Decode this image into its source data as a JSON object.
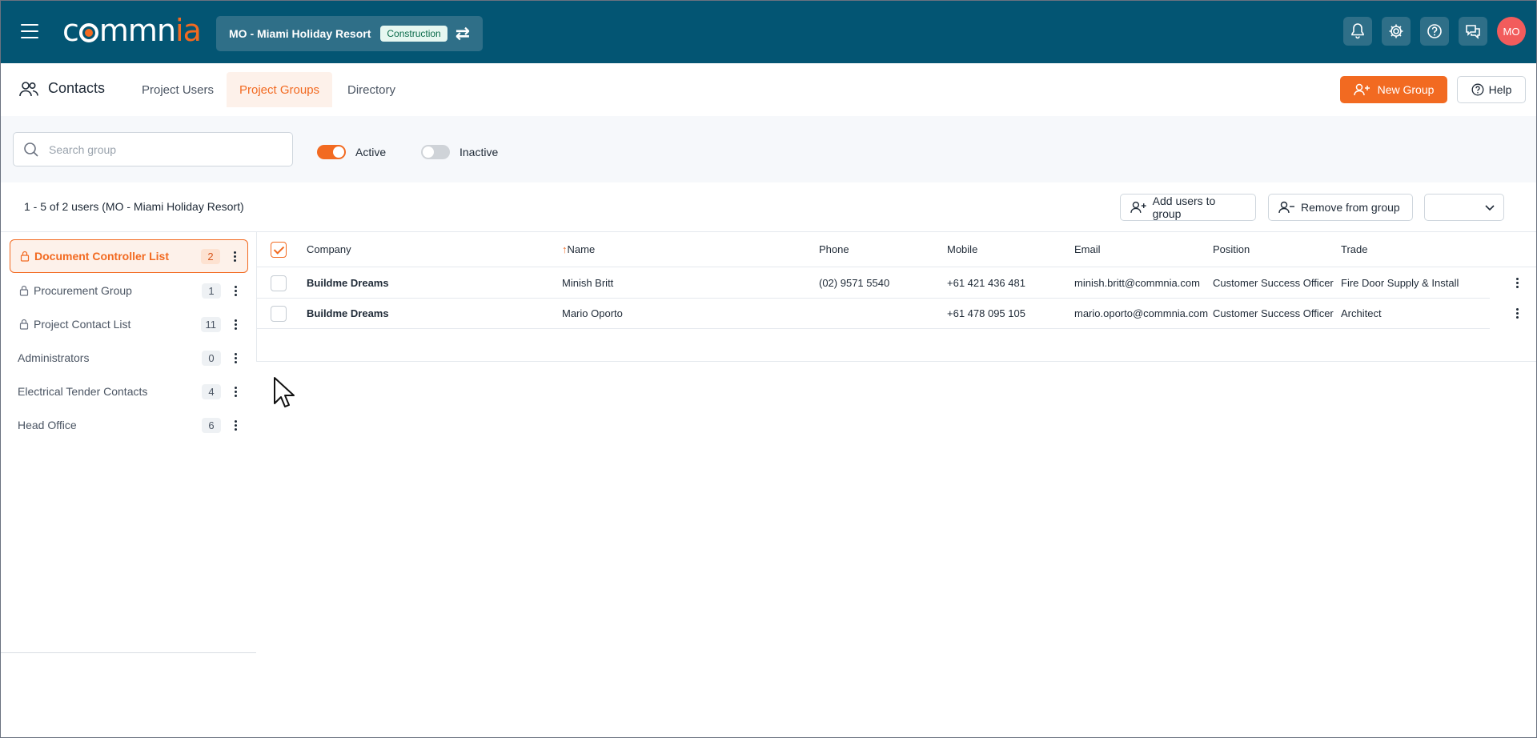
{
  "topbar": {
    "logo_part1": "c",
    "logo_part2": "mmn",
    "logo_accent": "ia",
    "project_name": "MO - Miami Holiday Resort",
    "project_badge": "Construction",
    "avatar_initials": "MO",
    "colors": {
      "bar": "#035573",
      "accent": "#f26a21",
      "avatar": "#f25c5c"
    }
  },
  "nav": {
    "title": "Contacts",
    "tabs": [
      {
        "label": "Project Users",
        "active": false
      },
      {
        "label": "Project Groups",
        "active": true
      },
      {
        "label": "Directory",
        "active": false
      }
    ],
    "new_group_label": "New Group",
    "help_label": "Help"
  },
  "filters": {
    "search_placeholder": "Search group",
    "active_label": "Active",
    "inactive_label": "Inactive",
    "active_on": true,
    "inactive_on": false
  },
  "toolbar": {
    "count_text": "1 - 5 of 2 users (MO - Miami Holiday Resort)",
    "add_users_label": "Add users to group",
    "remove_label": "Remove from group"
  },
  "groups": [
    {
      "name": "Document Controller List",
      "count": "2",
      "locked": true,
      "active": true
    },
    {
      "name": "Procurement Group",
      "count": "1",
      "locked": true,
      "active": false
    },
    {
      "name": "Project Contact List",
      "count": "11",
      "locked": true,
      "active": false
    },
    {
      "name": "Administrators",
      "count": "0",
      "locked": false,
      "active": false
    },
    {
      "name": "Electrical Tender Contacts",
      "count": "4",
      "locked": false,
      "active": false
    },
    {
      "name": "Head Office",
      "count": "6",
      "locked": false,
      "active": false
    }
  ],
  "table": {
    "columns": {
      "company": "Company",
      "sort_arrow": "↑",
      "name": "Name",
      "phone": "Phone",
      "mobile": "Mobile",
      "email": "Email",
      "position": "Position",
      "trade": "Trade"
    },
    "rows": [
      {
        "company": "Buildme Dreams",
        "name": "Minish Britt",
        "phone": "(02) 9571 5540",
        "mobile": "+61 421 436 481",
        "email": "minish.britt@commnia.com",
        "position": "Customer Success Officer",
        "trade": "Fire Door Supply & Install"
      },
      {
        "company": "Buildme Dreams",
        "name": "Mario Oporto",
        "phone": "",
        "mobile": "+61 478 095 105",
        "email": "mario.oporto@commnia.com",
        "position": "Customer Success Officer",
        "trade": "Architect"
      }
    ]
  }
}
